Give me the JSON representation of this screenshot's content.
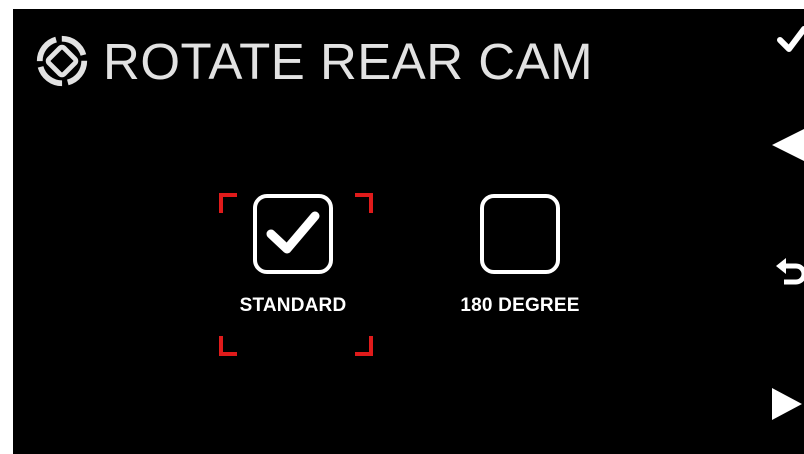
{
  "screen": {
    "title": "ROTATE REAR CAM",
    "header_icon": "rotate-screen-icon"
  },
  "options": [
    {
      "label": "STANDARD",
      "checked": true,
      "focused": true
    },
    {
      "label": "180 DEGREE",
      "checked": false,
      "focused": false
    }
  ],
  "side_buttons": [
    {
      "icon": "checkmark-icon"
    },
    {
      "icon": "left-arrow-icon"
    },
    {
      "icon": "return-icon"
    },
    {
      "icon": "right-arrow-icon"
    }
  ],
  "colors": {
    "background": "#000000",
    "text": "#ffffff",
    "focus": "#e01b1b"
  }
}
